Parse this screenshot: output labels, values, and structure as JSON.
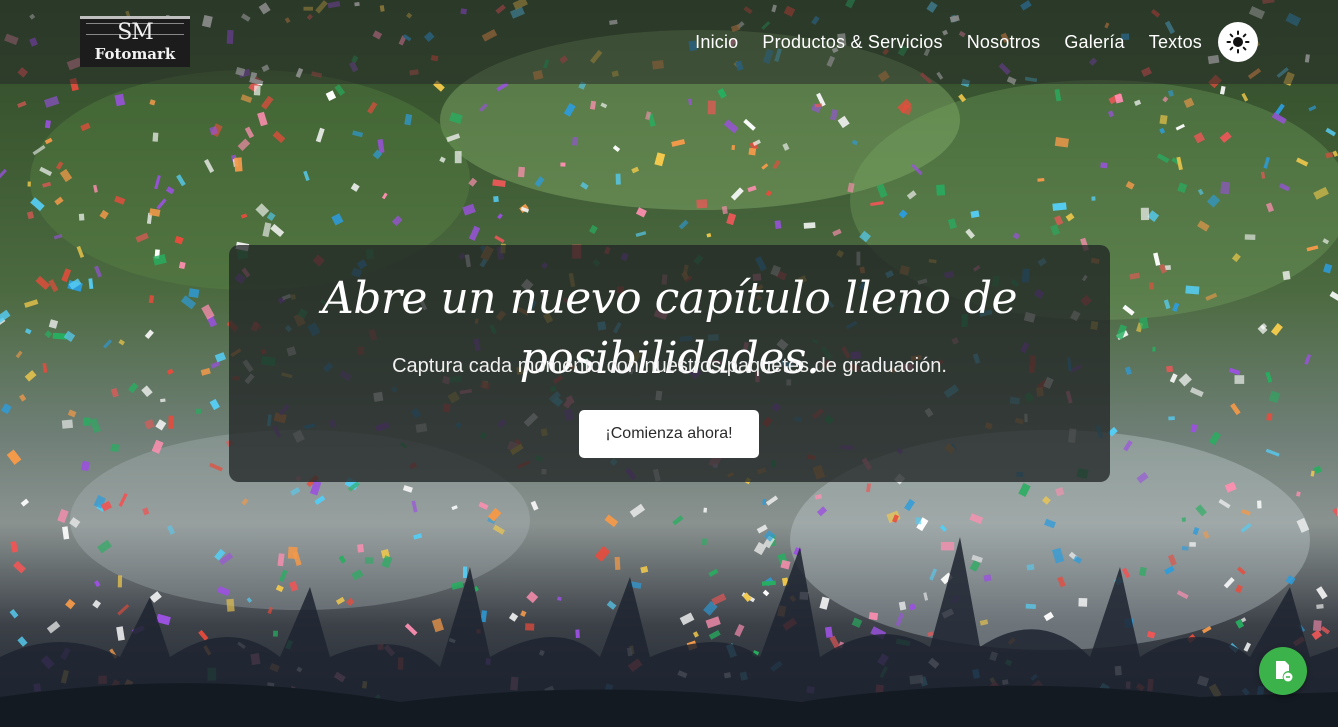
{
  "logo": {
    "top_text": "SM",
    "bottom_text": "Fotomark"
  },
  "nav": {
    "links": [
      {
        "label": "Inicio"
      },
      {
        "label": "Productos & Servicios"
      },
      {
        "label": "Nosotros"
      },
      {
        "label": "Galería"
      },
      {
        "label": "Textos"
      }
    ],
    "theme_toggle_icon": "sun-icon"
  },
  "hero": {
    "title": "Abre un nuevo capítulo lleno de posibilidades.",
    "subtitle": "Captura cada momento con nuestros paquetes de graduación.",
    "cta_label": "¡Comienza ahora!"
  },
  "chat_widget": {
    "icon": "chat-document-icon",
    "color": "#3bb34a"
  },
  "colors": {
    "card_background": "rgba(35,38,38,0.78)",
    "button_background": "#ffffff"
  }
}
